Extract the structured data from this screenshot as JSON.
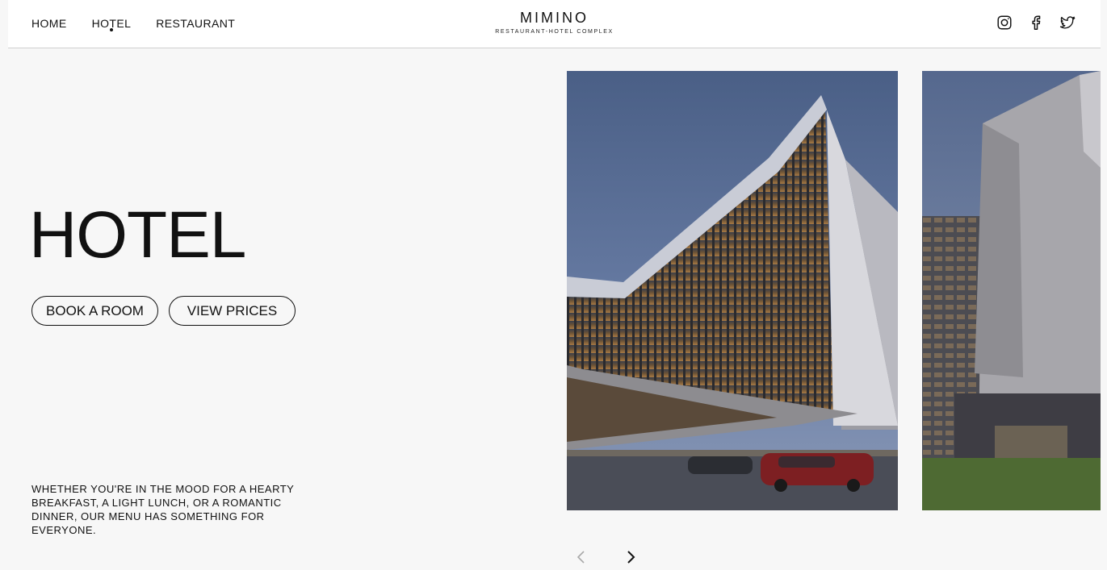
{
  "nav": {
    "items": [
      {
        "label": "HOME"
      },
      {
        "label": "HOTEL",
        "active": true
      },
      {
        "label": "RESTAURANT"
      }
    ]
  },
  "logo": {
    "title": "MIMINO",
    "subtitle": "RESTAURANT-HOTEL COMPLEX"
  },
  "social": {
    "icons": [
      "instagram-icon",
      "facebook-icon",
      "twitter-icon"
    ]
  },
  "hero": {
    "title": "HOTEL",
    "book_label": "BOOK A ROOM",
    "prices_label": "VIEW PRICES",
    "description": "WHETHER YOU'RE IN THE MOOD FOR A HEARTY BREAKFAST, A LIGHT LUNCH, OR A ROMANTIC DINNER, OUR MENU HAS SOMETHING FOR EVERYONE."
  },
  "gallery": {
    "prev_icon": "chevron-left-icon",
    "next_icon": "chevron-right-icon",
    "prev_disabled": true
  },
  "colors": {
    "background": "#f7f7f7",
    "header": "#ffffff",
    "text": "#111111"
  }
}
